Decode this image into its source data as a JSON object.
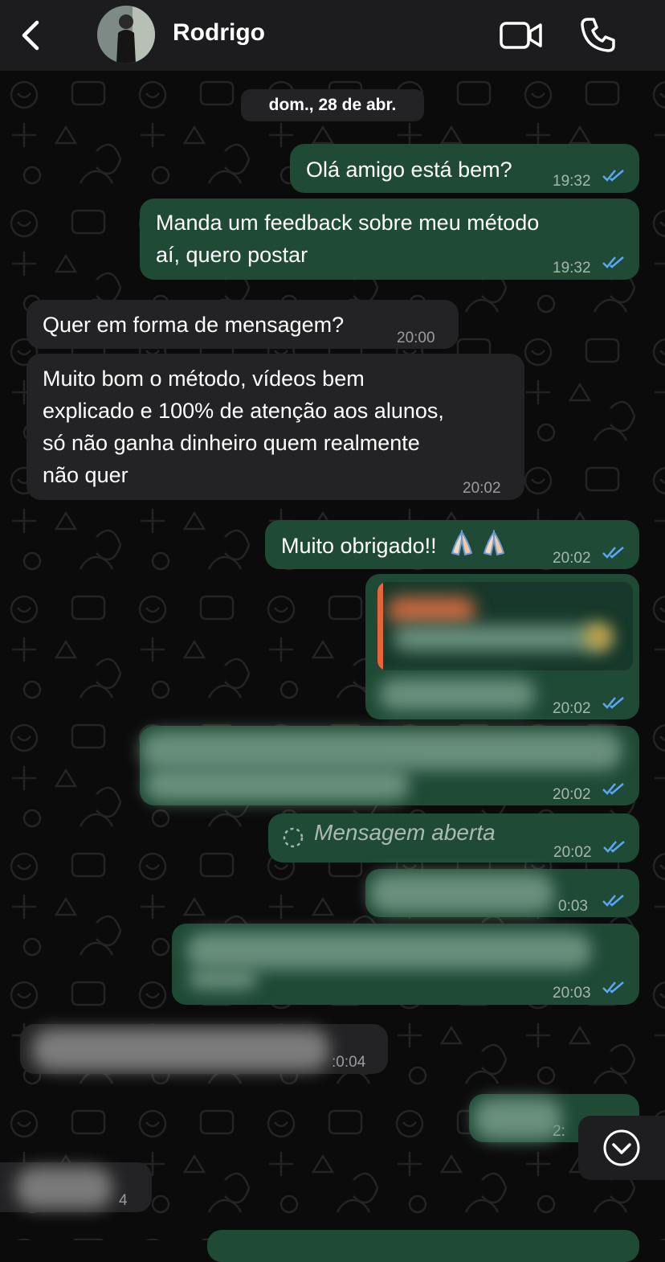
{
  "header": {
    "contact_name": "Rodrigo",
    "icons": [
      "chevron-left-icon",
      "video-camera-icon",
      "phone-icon"
    ]
  },
  "date_chip": "dom., 28 de abr.",
  "messages": [
    {
      "dir": "out",
      "text": "Olá amigo está bem?",
      "time": "19:32",
      "read": true
    },
    {
      "dir": "out",
      "text_lines": [
        "Manda um feedback sobre meu método",
        "aí, quero postar"
      ],
      "time": "19:32",
      "read": true
    },
    {
      "dir": "in",
      "text": "Quer em forma de mensagem?",
      "time": "20:00"
    },
    {
      "dir": "in",
      "text_lines": [
        "Muito bom o método, vídeos bem",
        "explicado e 100% de atenção aos alunos,",
        "só não ganha dinheiro quem realmente",
        "não quer"
      ],
      "time": "20:02"
    },
    {
      "dir": "out",
      "text": "Muito obrigado!!",
      "emoji": "folded-hands x2",
      "time": "20:02",
      "read": true
    },
    {
      "dir": "out",
      "redacted": true,
      "time": "20:02",
      "read": true
    },
    {
      "dir": "out",
      "redacted": true,
      "time": "20:02",
      "read": true
    },
    {
      "dir": "out",
      "text": "Mensagem aberta",
      "time": "20:02",
      "read": true
    },
    {
      "dir": "out",
      "redacted": true,
      "time": "0:03",
      "read": true
    },
    {
      "dir": "out",
      "redacted": true,
      "time": "20:03",
      "read": true
    },
    {
      "dir": "in",
      "redacted": true,
      "time": ":0:04"
    },
    {
      "dir": "out",
      "redacted": true,
      "time": "2:"
    },
    {
      "dir": "in",
      "redacted": true,
      "time": "4"
    }
  ],
  "colors": {
    "background": "#0b0b0b",
    "header": "#1c1c1e",
    "outgoing_bubble": "#1e4a36",
    "incoming_bubble": "#232325",
    "read_ticks": "#5aa8f5"
  },
  "scroll_button_icon": "chevron-down-circle-icon"
}
